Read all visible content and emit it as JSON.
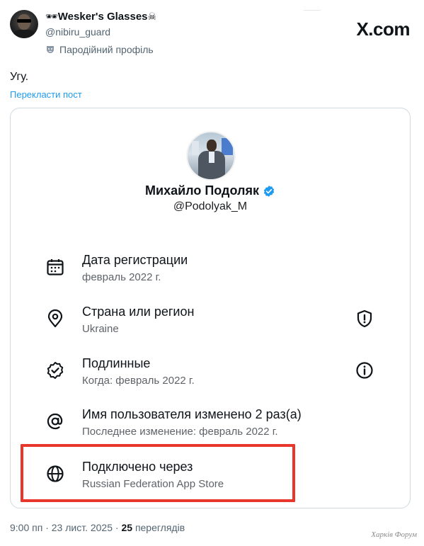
{
  "tweet": {
    "author": {
      "display_name": "Wesker's Glasses",
      "prefix_glyph": "🕶",
      "suffix_glyph": "☠",
      "handle": "@nibiru_guard",
      "parody_label": "Пародійний профіль"
    },
    "brand": "X.com",
    "text": "Угу.",
    "translate_link": "Перекласти пост",
    "footer": {
      "time": "9:00 пп",
      "date": "23 лист. 2025",
      "views_count": "25",
      "views_label": "переглядів"
    }
  },
  "card": {
    "profile": {
      "name": "Михайло Подоляк",
      "handle": "@Podolyak_M"
    },
    "rows": [
      {
        "icon": "calendar-icon",
        "title": "Дата регистрации",
        "sub": "февраль 2022 г.",
        "trail": ""
      },
      {
        "icon": "location-pin-icon",
        "title": "Страна или регион",
        "sub": "Ukraine",
        "trail": "shield-alert-icon"
      },
      {
        "icon": "verified-badge-outline-icon",
        "title": "Подлинные",
        "sub": "Когда: февраль 2022 г.",
        "trail": "info-icon"
      },
      {
        "icon": "at-sign-icon",
        "title": "Имя пользователя изменено 2 раз(а)",
        "sub": "Последнее изменение: февраль 2022 г.",
        "trail": ""
      },
      {
        "icon": "globe-icon",
        "title": "Подключено через",
        "sub": "Russian Federation App Store",
        "trail": ""
      }
    ],
    "highlight_color": "#e8372a"
  },
  "watermark": "Харків Форум",
  "colors": {
    "link": "#1d9bf0",
    "verified": "#1d9bf0",
    "muted": "#536471"
  }
}
